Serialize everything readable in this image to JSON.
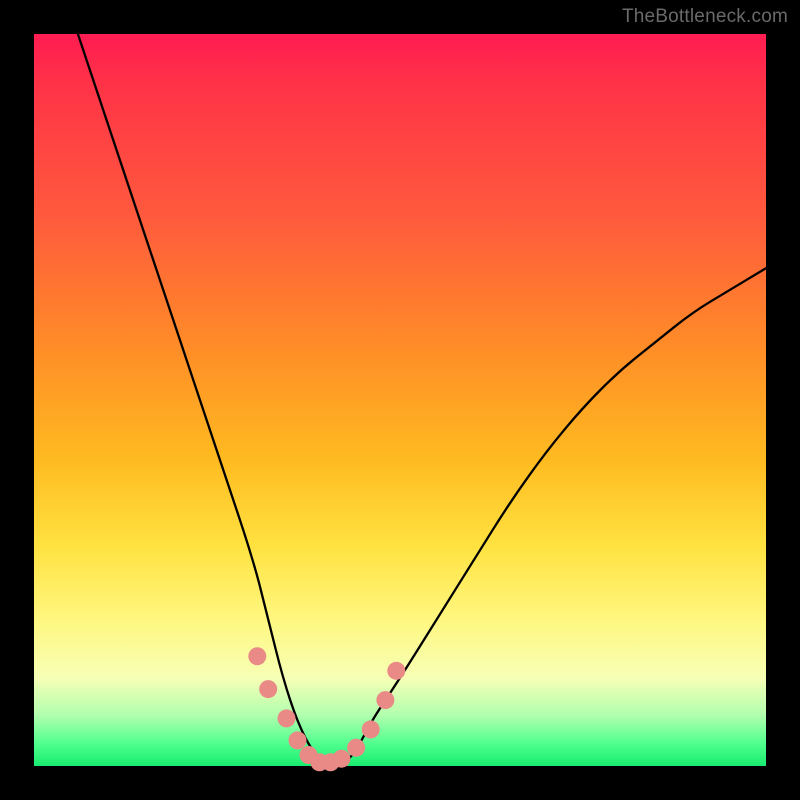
{
  "watermark": {
    "text": "TheBottleneck.com"
  },
  "chart_data": {
    "type": "line",
    "title": "",
    "xlabel": "",
    "ylabel": "",
    "xlim": [
      0,
      100
    ],
    "ylim": [
      0,
      100
    ],
    "grid": false,
    "legend": null,
    "background_gradient": [
      "#ff1c52",
      "#ff8a28",
      "#ffe240",
      "#fff780",
      "#17ec6f"
    ],
    "series": [
      {
        "name": "bottleneck-curve",
        "color": "#000000",
        "x": [
          6,
          10,
          14,
          18,
          22,
          26,
          30,
          32,
          34,
          36,
          38,
          40,
          42,
          44,
          46,
          50,
          55,
          60,
          65,
          70,
          75,
          80,
          85,
          90,
          95,
          100
        ],
        "y": [
          100,
          88,
          76,
          64,
          52,
          40,
          28,
          20,
          12,
          6,
          2,
          0,
          0,
          2,
          6,
          12,
          20,
          28,
          36,
          43,
          49,
          54,
          58,
          62,
          65,
          68
        ]
      },
      {
        "name": "highlight-dots",
        "color": "#e98a86",
        "type": "scatter",
        "x": [
          30.5,
          32.0,
          34.5,
          36.0,
          37.5,
          39.0,
          40.5,
          42.0,
          44.0,
          46.0,
          48.0,
          49.5
        ],
        "y": [
          15.0,
          10.5,
          6.5,
          3.5,
          1.5,
          0.5,
          0.5,
          1.0,
          2.5,
          5.0,
          9.0,
          13.0
        ]
      }
    ]
  }
}
